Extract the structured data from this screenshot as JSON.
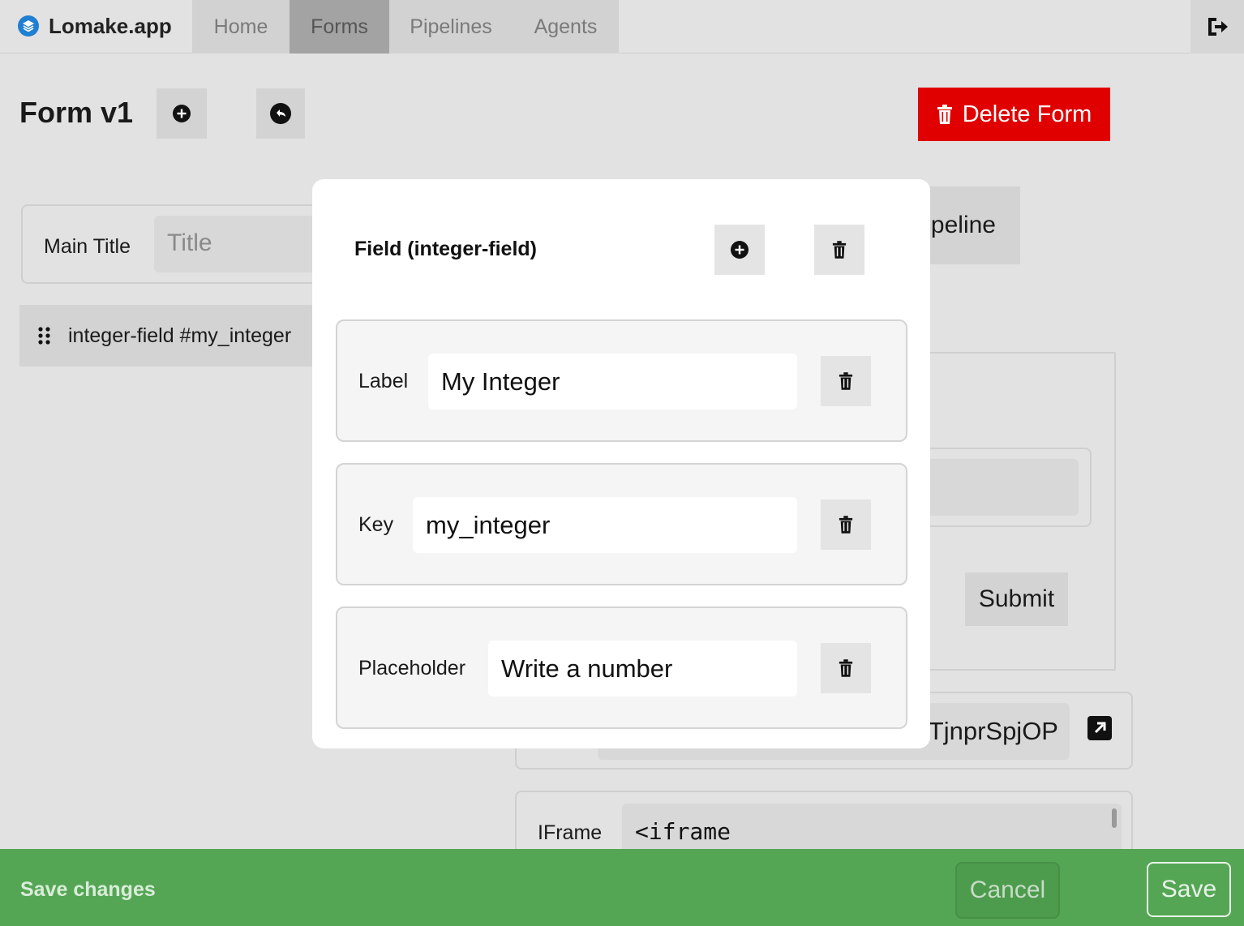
{
  "app": {
    "name": "Lomake.app"
  },
  "nav": {
    "tabs": [
      {
        "label": "Home"
      },
      {
        "label": "Forms",
        "active": true
      },
      {
        "label": "Pipelines"
      },
      {
        "label": "Agents"
      }
    ]
  },
  "page": {
    "title": "Form v1",
    "delete_label": "Delete Form"
  },
  "form_editor": {
    "main_title_label": "Main Title",
    "title_placeholder": "Title",
    "field_item": "integer-field #my_integer"
  },
  "right_panel": {
    "pipeline_button_partial": "peline",
    "submit_label": "Submit",
    "link_value_partial": "TjnprSpjOP",
    "iframe_label": "IFrame",
    "iframe_value": "<iframe"
  },
  "modal": {
    "title": "Field (integer-field)",
    "properties": [
      {
        "label": "Label",
        "value": "My Integer"
      },
      {
        "label": "Key",
        "value": "my_integer"
      },
      {
        "label": "Placeholder",
        "value": "Write a number"
      }
    ]
  },
  "bottom_bar": {
    "message": "Save changes",
    "cancel_label": "Cancel",
    "save_label": "Save"
  },
  "colors": {
    "danger": "#e10000",
    "success_bar": "#54a654",
    "brand_blue": "#1f7fd2"
  }
}
